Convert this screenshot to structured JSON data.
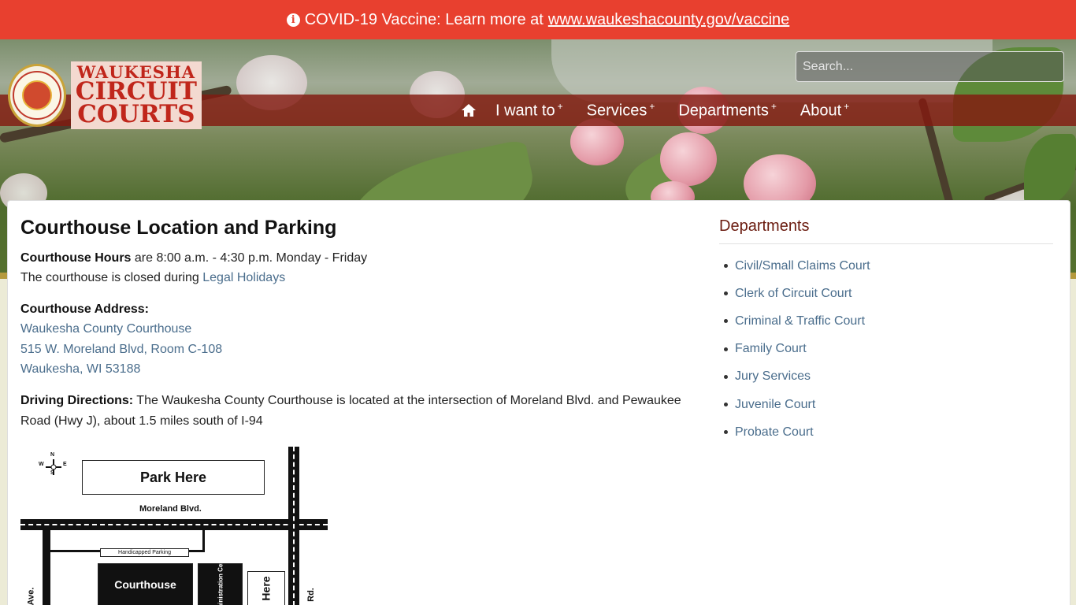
{
  "alert": {
    "text": "COVID-19 Vaccine: Learn more at",
    "link": "www.waukeshacounty.gov/vaccine"
  },
  "logo": {
    "line1": "WAUKESHA",
    "line2": "CIRCUIT",
    "line3": "COURTS",
    "seal_text": "WAUKESHA COUNTY CIRCUIT COURTS"
  },
  "search": {
    "placeholder": "Search..."
  },
  "nav": {
    "items": [
      {
        "label": "I want to",
        "suffix": "+"
      },
      {
        "label": "Services",
        "suffix": "+"
      },
      {
        "label": "Departments",
        "suffix": "+"
      },
      {
        "label": "About",
        "suffix": "+"
      }
    ]
  },
  "main": {
    "title": "Courthouse Location and Parking",
    "hours_label": "Courthouse Hours",
    "hours_text": " are 8:00 a.m. - 4:30 p.m. Monday - Friday",
    "closed_text": "The courthouse is closed during ",
    "holidays_link": "Legal Holidays",
    "address_label": "Courthouse Address:",
    "address_lines": [
      "Waukesha County Courthouse",
      "515 W. Moreland Blvd, Room C-108",
      "Waukesha, WI 53188"
    ],
    "directions_label": "Driving Directions:",
    "directions_text": " The Waukesha County Courthouse is located at the intersection of Moreland Blvd. and Pewaukee Road (Hwy J), about 1.5 miles south of I-94"
  },
  "map": {
    "park_here": "Park Here",
    "street": "Moreland Blvd.",
    "handicapped": "Handicapped Parking",
    "courthouse": "Courthouse",
    "admin": "Administration Center",
    "here": "Here",
    "ave": "Ave.",
    "rd": "Rd.",
    "compass": {
      "n": "N",
      "s": "S",
      "e": "E",
      "w": "W"
    }
  },
  "sidebar": {
    "title": "Departments",
    "items": [
      "Civil/Small Claims Court",
      "Clerk of Circuit Court",
      "Criminal & Traffic Court",
      "Family Court",
      "Jury Services",
      "Juvenile Court",
      "Probate Court"
    ]
  }
}
